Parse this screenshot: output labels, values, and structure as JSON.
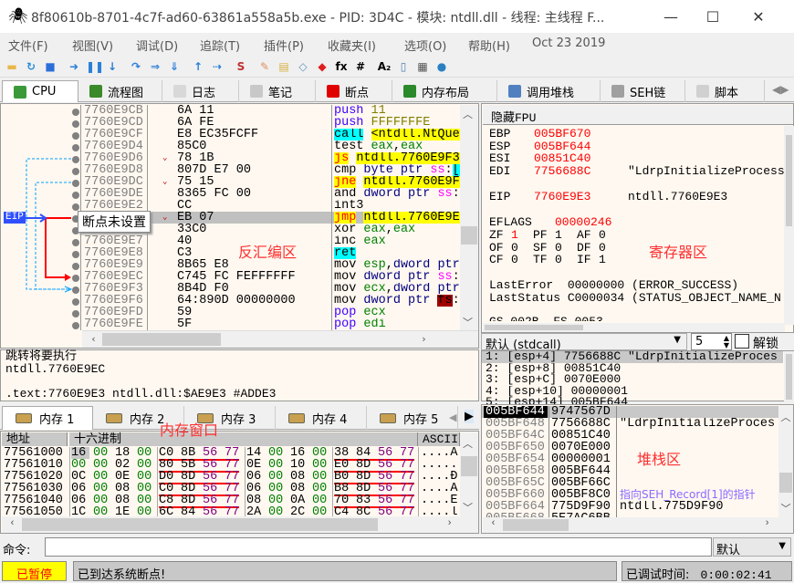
{
  "window": {
    "title": "8f80610b-8701-4c7f-ad60-63861a558a5b.exe - PID: 3D4C - 模块: ntdll.dll - 线程: 主线程 F...",
    "minimize": "—",
    "maximize": "☐",
    "close": "✕"
  },
  "menu": [
    "文件(F)",
    "视图(V)",
    "调试(D)",
    "追踪(T)",
    "插件(P)",
    "收藏夹(I)",
    "选项(O)",
    "帮助(H)",
    "Oct 23 2019"
  ],
  "toolbar": {
    "icons": [
      {
        "name": "open-icon",
        "glyph": "▬",
        "color": "#e8b84a"
      },
      {
        "name": "restart-icon",
        "glyph": "↻",
        "color": "#2a8fd8"
      },
      {
        "name": "stop-icon",
        "glyph": "■",
        "color": "#2a6fd8"
      },
      {
        "name": "run-icon",
        "glyph": "➜",
        "color": "#2a7fd8"
      },
      {
        "name": "pause-icon",
        "glyph": "❚❚",
        "color": "#2a7fd8"
      },
      {
        "name": "step-into-icon",
        "glyph": "↓",
        "color": "#2a7fd8"
      },
      {
        "name": "step-over-icon",
        "glyph": "↷",
        "color": "#2a7fd8"
      },
      {
        "name": "trace-into-icon",
        "glyph": "⇒",
        "color": "#2a7fd8"
      },
      {
        "name": "trace-over-icon",
        "glyph": "⇓",
        "color": "#2a7fd8"
      },
      {
        "name": "execute-till-return-icon",
        "glyph": "↑",
        "color": "#2a7fd8"
      },
      {
        "name": "run-to-user-code-icon",
        "glyph": "⇢",
        "color": "#2a7fd8"
      },
      {
        "name": "scylla-icon",
        "glyph": "S",
        "color": "#c03030"
      },
      {
        "name": "patch-icon",
        "glyph": "✎",
        "color": "#e09060"
      },
      {
        "name": "comments-icon",
        "glyph": "▤",
        "color": "#d8b040"
      },
      {
        "name": "labels-icon",
        "glyph": "◇",
        "color": "#6090c0"
      },
      {
        "name": "bookmarks-icon",
        "glyph": "◆",
        "color": "#e02020"
      },
      {
        "name": "functions-icon",
        "glyph": "fx",
        "color": "#000"
      },
      {
        "name": "hash-icon",
        "glyph": "#",
        "color": "#000"
      },
      {
        "name": "strings-icon",
        "glyph": "A₂",
        "color": "#000"
      },
      {
        "name": "device-icon",
        "glyph": "▯",
        "color": "#5080b0"
      },
      {
        "name": "calculator-icon",
        "glyph": "▦",
        "color": "#555"
      },
      {
        "name": "globe-icon",
        "glyph": "●",
        "color": "#2a80c0"
      }
    ]
  },
  "tabs": [
    {
      "label": "CPU",
      "icon": "cpu-icon",
      "color": "#3a9a3a"
    },
    {
      "label": "流程图",
      "icon": "tree-icon",
      "color": "#3a8a2a"
    },
    {
      "label": "日志",
      "icon": "log-icon",
      "color": "#d8d8d8"
    },
    {
      "label": "笔记",
      "icon": "notes-icon",
      "color": "#c8c8c8"
    },
    {
      "label": "断点",
      "icon": "breakpoint-icon",
      "color": "#e00000"
    },
    {
      "label": "内存布局",
      "icon": "memory-map-icon",
      "color": "#2a8a2a"
    },
    {
      "label": "调用堆栈",
      "icon": "call-stack-icon",
      "color": "#5080c0"
    },
    {
      "label": "SEH链",
      "icon": "seh-icon",
      "color": "#a0a0a0"
    },
    {
      "label": "脚本",
      "icon": "script-icon",
      "color": "#d0d0d0"
    }
  ],
  "disasm": {
    "eip_label": "EIP",
    "tooltip": "断点未设置",
    "annotation": "反汇编区",
    "rows": [
      {
        "addr": "7760E9CB",
        "bytes": "6A 11",
        "ins": [
          [
            "push",
            "t-push"
          ],
          [
            " "
          ],
          [
            "11",
            "t-num"
          ]
        ]
      },
      {
        "addr": "7760E9CD",
        "bytes": "6A FE",
        "ins": [
          [
            "push",
            "t-push"
          ],
          [
            " "
          ],
          [
            "FFFFFFFE",
            "t-num"
          ]
        ]
      },
      {
        "addr": "7760E9CF",
        "bytes": "E8 EC35FCFF",
        "ins": [
          [
            "call",
            "t-call"
          ],
          [
            " "
          ],
          [
            "<ntdll.NtQue",
            "t-callop"
          ]
        ]
      },
      {
        "addr": "7760E9D4",
        "bytes": "85C0",
        "ins": [
          [
            "test"
          ],
          [
            " "
          ],
          [
            "eax",
            "t-reg"
          ],
          [
            ","
          ],
          [
            "eax",
            "t-reg"
          ]
        ]
      },
      {
        "addr": "7760E9D6",
        "bytes": "78 1B",
        "jump": true,
        "ins": [
          [
            "js",
            "t-jmp"
          ],
          [
            " "
          ],
          [
            "ntdll.7760E9F3",
            "t-jmpop"
          ]
        ]
      },
      {
        "addr": "7760E9D8",
        "bytes": "807D E7 00",
        "ins": [
          [
            "cmp"
          ],
          [
            " "
          ],
          [
            "byte ptr",
            "t-ptr"
          ],
          [
            " "
          ],
          [
            "ss",
            "t-seg"
          ],
          [
            ":"
          ],
          [
            "[",
            "t-call"
          ]
        ]
      },
      {
        "addr": "7760E9DC",
        "bytes": "75 15",
        "jump": true,
        "ins": [
          [
            "jne",
            "t-jmp"
          ],
          [
            " "
          ],
          [
            "ntdll.7760E9F",
            "t-jmpop"
          ]
        ]
      },
      {
        "addr": "7760E9DE",
        "bytes": "8365 FC 00",
        "ins": [
          [
            "and"
          ],
          [
            " "
          ],
          [
            "dword ptr",
            "t-ptr"
          ],
          [
            " "
          ],
          [
            "ss",
            "t-seg"
          ],
          [
            ":"
          ]
        ]
      },
      {
        "addr": "7760E9E2",
        "bytes": "CC",
        "ins": [
          [
            "int3"
          ]
        ]
      },
      {
        "addr": "7760E9E3",
        "bytes": "EB 07",
        "jump": true,
        "selected": true,
        "ins": [
          [
            "jmp",
            "t-jmp"
          ],
          [
            " "
          ],
          [
            "ntdll.7760E9EC",
            "t-jmpop"
          ]
        ]
      },
      {
        "addr": "7760E9E5",
        "bytes": "33C0",
        "ins": [
          [
            "xor"
          ],
          [
            " "
          ],
          [
            "eax",
            "t-reg"
          ],
          [
            ","
          ],
          [
            "eax",
            "t-reg"
          ]
        ]
      },
      {
        "addr": "7760E9E7",
        "bytes": "40",
        "ins": [
          [
            "inc"
          ],
          [
            " "
          ],
          [
            "eax",
            "t-reg"
          ]
        ]
      },
      {
        "addr": "7760E9E8",
        "bytes": "C3",
        "ins": [
          [
            "ret",
            "t-ret"
          ]
        ]
      },
      {
        "addr": "7760E9E9",
        "bytes": "8B65 E8",
        "ins": [
          [
            "mov"
          ],
          [
            " "
          ],
          [
            "esp",
            "t-reg"
          ],
          [
            ","
          ],
          [
            "dword ptr",
            "t-ptr"
          ]
        ]
      },
      {
        "addr": "7760E9EC",
        "bytes": "C745 FC FEFFFFFF",
        "ins": [
          [
            "mov"
          ],
          [
            " "
          ],
          [
            "dword ptr",
            "t-ptr"
          ],
          [
            " "
          ],
          [
            "ss",
            "t-seg"
          ],
          [
            ":"
          ]
        ]
      },
      {
        "addr": "7760E9F3",
        "bytes": "8B4D F0",
        "ins": [
          [
            "mov"
          ],
          [
            " "
          ],
          [
            "ecx",
            "t-reg"
          ],
          [
            ","
          ],
          [
            "dword ptr",
            "t-ptr"
          ]
        ]
      },
      {
        "addr": "7760E9F6",
        "bytes": "64:890D 00000000",
        "ins": [
          [
            "mov"
          ],
          [
            " "
          ],
          [
            "dword ptr",
            "t-ptr"
          ],
          [
            " "
          ],
          [
            "fs",
            "t-fs"
          ],
          [
            ":"
          ]
        ]
      },
      {
        "addr": "7760E9FD",
        "bytes": "59",
        "ins": [
          [
            "pop",
            "t-push"
          ],
          [
            " "
          ],
          [
            "ecx",
            "t-reg"
          ]
        ]
      },
      {
        "addr": "7760E9FE",
        "bytes": "5F",
        "ins": [
          [
            "pop",
            "t-push"
          ],
          [
            " "
          ],
          [
            "edi",
            "t-reg"
          ]
        ]
      }
    ]
  },
  "info": {
    "lines": [
      "跳转将要执行",
      "ntdll.7760E9EC",
      "",
      ".text:7760E9E3 ntdll.dll:$AE9E3 #ADDE3"
    ]
  },
  "registers": {
    "hide_fpu": "隐藏FPU",
    "annotation": "寄存器区",
    "gp": [
      {
        "name": "EBP",
        "value": "005BF670",
        "comment": ""
      },
      {
        "name": "ESP",
        "value": "005BF644",
        "comment": ""
      },
      {
        "name": "ESI",
        "value": "00851C40",
        "comment": ""
      },
      {
        "name": "EDI",
        "value": "7756688C",
        "comment": "\"LdrpInitializeProcess"
      }
    ],
    "eip": {
      "name": "EIP",
      "value": "7760E9E3",
      "comment": "ntdll.7760E9E3"
    },
    "eflags": {
      "name": "EFLAGS",
      "value": "00000246"
    },
    "flags": [
      [
        {
          "n": "ZF",
          "v": "1",
          "changed": true
        },
        {
          "n": "PF",
          "v": "1"
        },
        {
          "n": "AF",
          "v": "0"
        }
      ],
      [
        {
          "n": "OF",
          "v": "0"
        },
        {
          "n": "SF",
          "v": "0"
        },
        {
          "n": "DF",
          "v": "0"
        }
      ],
      [
        {
          "n": "CF",
          "v": "0"
        },
        {
          "n": "TF",
          "v": "0"
        },
        {
          "n": "IF",
          "v": "1"
        }
      ]
    ],
    "last_error": "LastError  00000000 (ERROR_SUCCESS)",
    "last_status": "LastStatus C0000034 (STATUS_OBJECT_NAME_N",
    "segments_partial": "GS 002B  FS 0053"
  },
  "callconv": {
    "selected": "默认 (stdcall)",
    "count": "5",
    "unlock_label": "解锁",
    "unlock_checked": false
  },
  "args": [
    "1: [esp+4] 7756688C \"LdrpInitializeProces",
    "2: [esp+8] 00851C40",
    "3: [esp+C] 0070E000",
    "4: [esp+10] 00000001",
    "5: [esp+14] 005BF644"
  ],
  "memory": {
    "tabs": [
      "内存 1",
      "内存 2",
      "内存 3",
      "内存 4",
      "内存 5"
    ],
    "annotation": "内存窗口",
    "headers": {
      "address": "地址",
      "hex": "十六进制",
      "ascii": "ASCII"
    },
    "rows": [
      {
        "addr": "77561000",
        "bytes": [
          "16",
          "00",
          "18",
          "00",
          "C0",
          "8B",
          "56",
          "77",
          "14",
          "00",
          "16",
          "00",
          "38",
          "84",
          "56",
          "77"
        ],
        "ascii": "....À"
      },
      {
        "addr": "77561010",
        "bytes": [
          "00",
          "00",
          "02",
          "00",
          "80",
          "5B",
          "56",
          "77",
          "0E",
          "00",
          "10",
          "00",
          "E0",
          "8D",
          "56",
          "77"
        ],
        "ascii": "......"
      },
      {
        "addr": "77561020",
        "bytes": [
          "0C",
          "00",
          "0E",
          "00",
          "D0",
          "8D",
          "56",
          "77",
          "06",
          "00",
          "08",
          "00",
          "B0",
          "8D",
          "56",
          "77"
        ],
        "ascii": "....Ð"
      },
      {
        "addr": "77561030",
        "bytes": [
          "06",
          "00",
          "08",
          "00",
          "C0",
          "8D",
          "56",
          "77",
          "06",
          "00",
          "08",
          "00",
          "B8",
          "8D",
          "56",
          "77"
        ],
        "ascii": "....À"
      },
      {
        "addr": "77561040",
        "bytes": [
          "06",
          "00",
          "08",
          "00",
          "C8",
          "8D",
          "56",
          "77",
          "08",
          "00",
          "0A",
          "00",
          "70",
          "83",
          "56",
          "77"
        ],
        "ascii": "....È"
      },
      {
        "addr": "77561050",
        "bytes": [
          "1C",
          "00",
          "1E",
          "00",
          "6C",
          "84",
          "56",
          "77",
          "2A",
          "00",
          "2C",
          "00",
          "C4",
          "8C",
          "56",
          "77"
        ],
        "ascii": "....l"
      }
    ]
  },
  "stack": {
    "annotation": "堆栈区",
    "rows": [
      {
        "addr": "005BF644",
        "value": "9747567D",
        "comment": "",
        "current": true
      },
      {
        "addr": "005BF648",
        "value": "7756688C",
        "comment": "\"LdrpInitializeProces"
      },
      {
        "addr": "005BF64C",
        "value": "00851C40",
        "comment": ""
      },
      {
        "addr": "005BF650",
        "value": "0070E000",
        "comment": ""
      },
      {
        "addr": "005BF654",
        "value": "00000001",
        "comment": ""
      },
      {
        "addr": "005BF658",
        "value": "005BF644",
        "comment": ""
      },
      {
        "addr": "005BF65C",
        "value": "005BF66C",
        "comment": ""
      },
      {
        "addr": "005BF660",
        "value": "005BF8C0",
        "comment": "指向SEH_Record[1]的指针",
        "seh": true
      },
      {
        "addr": "005BF664",
        "value": "775D9F90",
        "comment": "ntdll.775D9F90"
      },
      {
        "addr": "005BF668",
        "value": "5E7AC6BB",
        "comment": ""
      }
    ]
  },
  "command": {
    "label": "命令:",
    "value": "",
    "mode": "默认"
  },
  "status": {
    "state": "已暂停",
    "message": "已到达系统断点!",
    "time_label": "已调试时间:",
    "time": "0:00:02:41",
    "state_bg": "#ffff00",
    "state_color": "#ff0000"
  }
}
